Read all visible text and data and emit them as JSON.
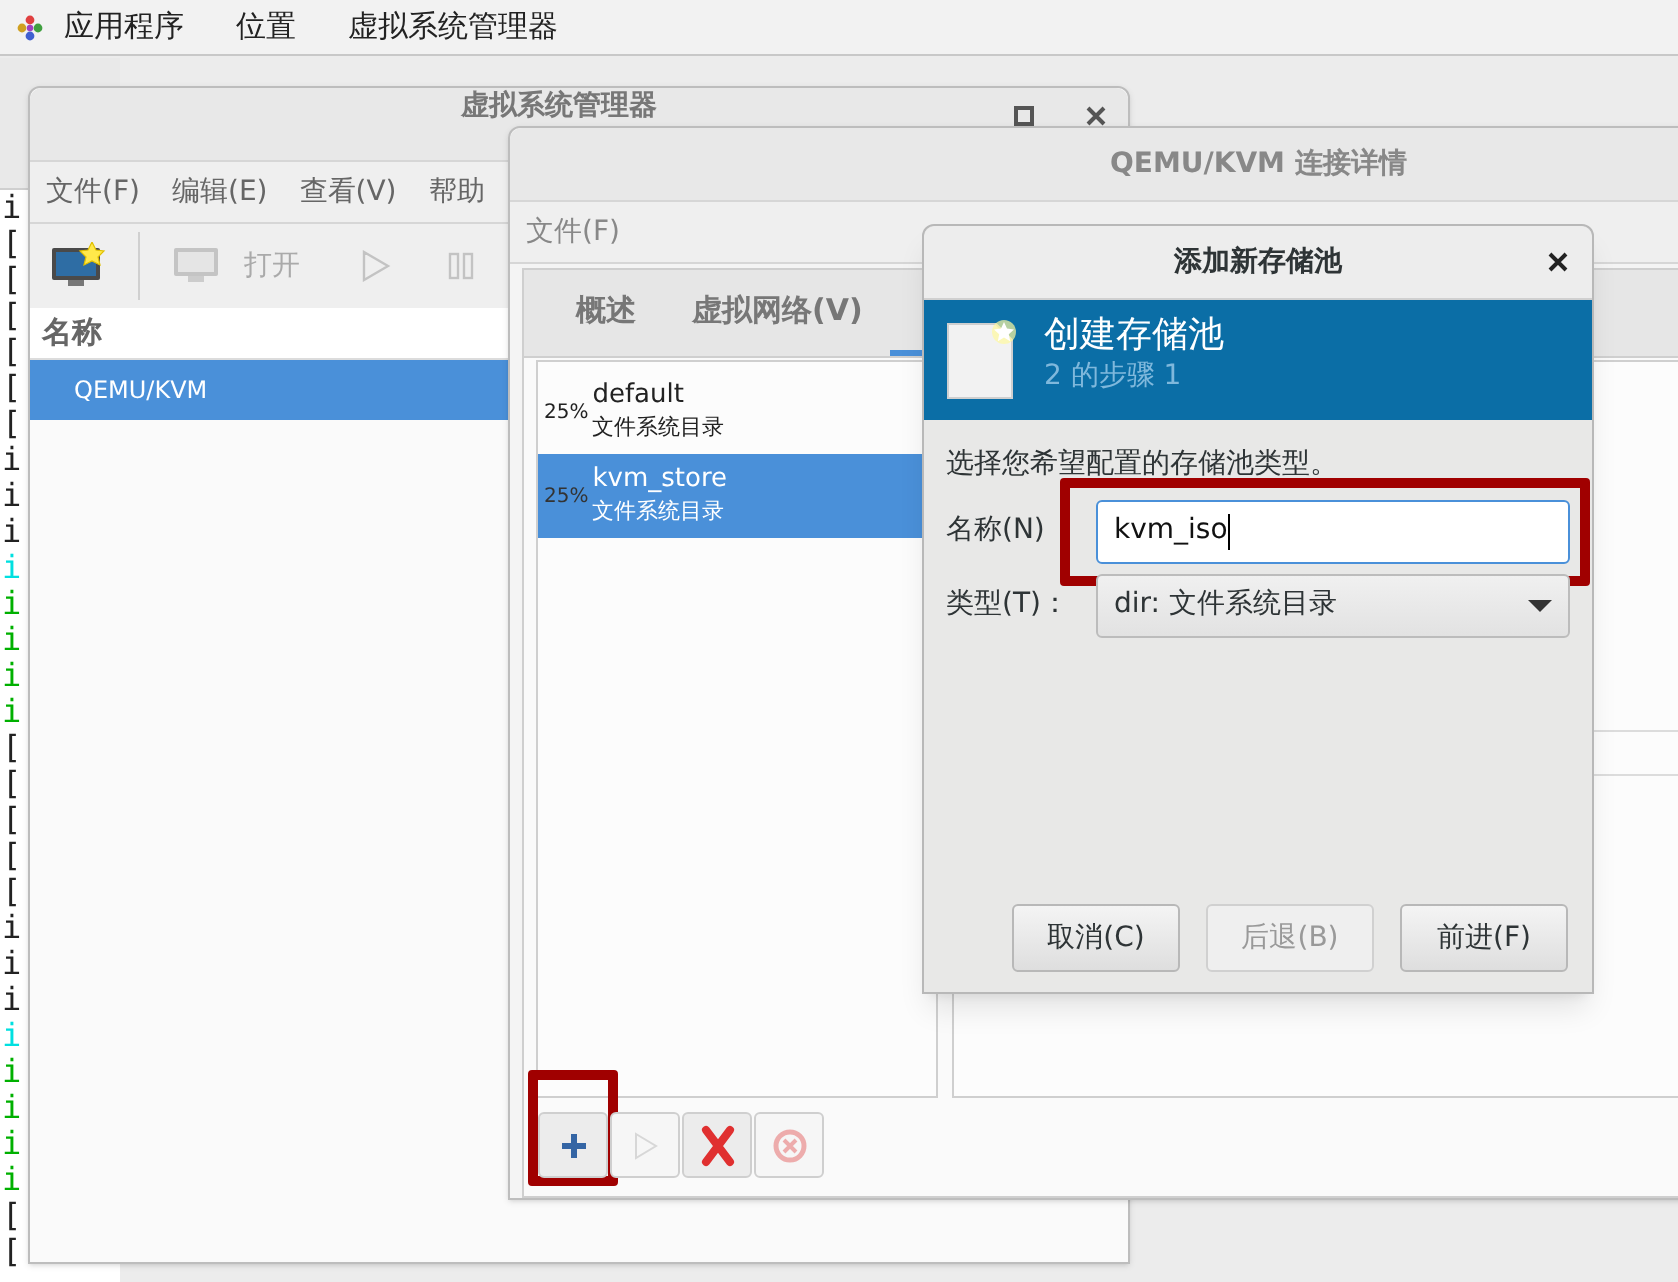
{
  "top_bar": {
    "menus": [
      "应用程序",
      "位置",
      "虚拟系统管理器"
    ]
  },
  "terminal": {
    "lines": [
      {
        "text": "i",
        "color": "#222222"
      },
      {
        "text": "[",
        "color": "#222222"
      },
      {
        "text": "[",
        "color": "#222222"
      },
      {
        "text": "[",
        "color": "#222222"
      },
      {
        "text": "[",
        "color": "#222222"
      },
      {
        "text": "[",
        "color": "#222222"
      },
      {
        "text": "[",
        "color": "#222222"
      },
      {
        "text": "i",
        "color": "#222222"
      },
      {
        "text": "i",
        "color": "#222222"
      },
      {
        "text": "i",
        "color": "#222222"
      },
      {
        "text": "i",
        "color": "#00e0e0"
      },
      {
        "text": "i",
        "color": "#00b000"
      },
      {
        "text": "i",
        "color": "#00b000"
      },
      {
        "text": "i",
        "color": "#00b000"
      },
      {
        "text": "i",
        "color": "#00b000"
      },
      {
        "text": "[",
        "color": "#222222"
      },
      {
        "text": "[",
        "color": "#222222"
      },
      {
        "text": "[",
        "color": "#222222"
      },
      {
        "text": "[",
        "color": "#222222"
      },
      {
        "text": "[",
        "color": "#222222"
      },
      {
        "text": "i",
        "color": "#222222"
      },
      {
        "text": "i",
        "color": "#222222"
      },
      {
        "text": "i",
        "color": "#222222"
      },
      {
        "text": "i",
        "color": "#00e0e0"
      },
      {
        "text": "i",
        "color": "#00b000"
      },
      {
        "text": "i",
        "color": "#00b000"
      },
      {
        "text": "i",
        "color": "#00b000"
      },
      {
        "text": "i",
        "color": "#00b000"
      },
      {
        "text": "[",
        "color": "#222222"
      },
      {
        "text": "[",
        "color": "#222222"
      }
    ]
  },
  "manager": {
    "title": "虚拟系统管理器",
    "menus": [
      "文件(F)",
      "编辑(E)",
      "查看(V)",
      "帮助"
    ],
    "toolbar": [
      {
        "kind": "new",
        "disabled": false
      },
      {
        "kind": "separator"
      },
      {
        "kind": "open",
        "label": "打开",
        "disabled": true
      },
      {
        "kind": "run",
        "disabled": true
      },
      {
        "kind": "pause",
        "disabled": true
      }
    ],
    "column": "名称",
    "rows": [
      {
        "name": "QEMU/KVM",
        "selected": true
      }
    ]
  },
  "details": {
    "title": "QEMU/KVM 连接详情",
    "menus": [
      "文件(F)"
    ],
    "tabs": [
      {
        "label": "概述",
        "selected": false
      },
      {
        "label": "虚拟网络(V)",
        "selected": false
      },
      {
        "selected": true
      }
    ],
    "pools": [
      {
        "usage": "25%",
        "name": "default",
        "type": "文件系统目录",
        "selected": false
      },
      {
        "usage": "25%",
        "name": "kvm_store",
        "type": "文件系统目录",
        "selected": true
      }
    ],
    "pool_buttons": [
      {
        "kind": "add",
        "disabled": false,
        "highlighted": true
      },
      {
        "kind": "start",
        "disabled": true,
        "highlighted": false
      },
      {
        "kind": "delete",
        "disabled": false,
        "highlighted": false
      },
      {
        "kind": "stop",
        "disabled": true,
        "highlighted": false
      }
    ]
  },
  "dialog": {
    "title": "添加新存储池",
    "header": {
      "title": "创建存储池",
      "step": "2 的步骤 1"
    },
    "prompt": "选择您希望配置的存储池类型。",
    "fields": [
      {
        "kind": "text",
        "label": "名称(N)",
        "value": "kvm_iso",
        "focused": true,
        "highlighted": true
      },
      {
        "kind": "select",
        "label": "类型(T)：",
        "value": "dir: 文件系统目录",
        "focused": false,
        "highlighted": false
      }
    ],
    "buttons": [
      {
        "label": "取消(C)",
        "disabled": false
      },
      {
        "label": "后退(B)",
        "disabled": true
      },
      {
        "label": "前进(F)",
        "disabled": false
      }
    ]
  }
}
